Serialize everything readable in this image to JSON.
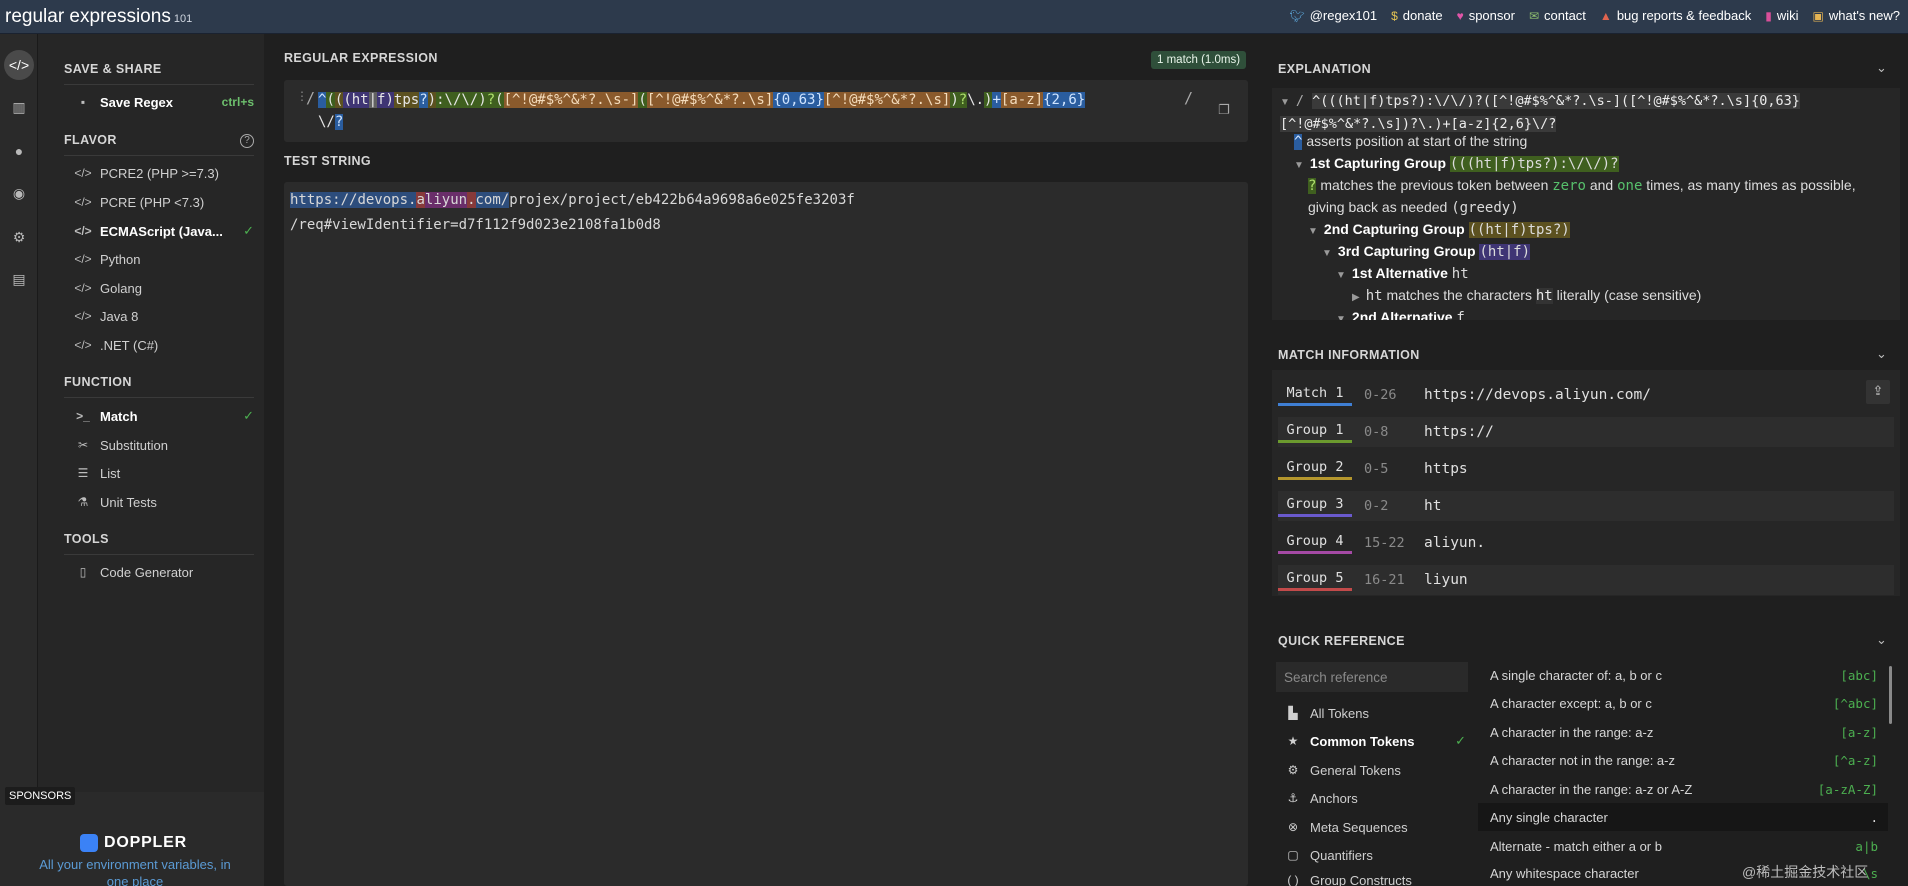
{
  "app": {
    "logo_main": "regular",
    "logo_rest": " expressions",
    "version": "101"
  },
  "top_links": [
    {
      "label": "@regex101",
      "icon": "twitter-icon"
    },
    {
      "label": "donate",
      "icon": "dollar-icon"
    },
    {
      "label": "sponsor",
      "icon": "heart-icon"
    },
    {
      "label": "contact",
      "icon": "mail-icon"
    },
    {
      "label": "bug reports & feedback",
      "icon": "warning-icon"
    },
    {
      "label": "wiki",
      "icon": "book-icon"
    },
    {
      "label": "what's new?",
      "icon": "news-icon"
    }
  ],
  "sidebar": {
    "save_header": "SAVE & SHARE",
    "save_label": "Save Regex",
    "save_shortcut": "ctrl+s",
    "flavor_header": "FLAVOR",
    "flavors": [
      "PCRE2 (PHP >=7.3)",
      "PCRE (PHP <7.3)",
      "ECMAScript (Java...",
      "Python",
      "Golang",
      "Java 8",
      ".NET (C#)"
    ],
    "function_header": "FUNCTION",
    "functions": [
      "Match",
      "Substitution",
      "List",
      "Unit Tests"
    ],
    "tools_header": "TOOLS",
    "tools": [
      "Code Generator"
    ]
  },
  "sponsor": {
    "label": "SPONSORS",
    "name": "DOPPLER",
    "text": "All your environment variables, in one place"
  },
  "regex": {
    "header": "REGULAR EXPRESSION",
    "match_badge": "1 match (1.0ms)",
    "delim_open": "/",
    "delim_close": "/",
    "parts": [
      "^",
      "(",
      "(",
      "(",
      "ht",
      "|",
      "f",
      ")",
      "tps",
      "?",
      ")",
      ":\\/\\/",
      ")",
      "?",
      "(",
      "[^!@#$%^&*?.\\s-]",
      "(",
      "[^!@#$%^&*?.\\s]",
      "{0,63}",
      "[^!@#$%^&*?.\\s]",
      ")",
      "?",
      "\\.",
      ")",
      "+",
      "[a-z]",
      "{2,6}",
      "\\/",
      "?"
    ]
  },
  "test_string": {
    "header": "TEST STRING",
    "m_https": "https",
    "m_sep": "://",
    "m_devops": "devops.",
    "m_a": "a",
    "m_liyun": "liyun",
    "m_dot": ".",
    "m_com": "com/",
    "rest_line1": "projex/project/eb422b64a9698a6e025fe3203f",
    "line2": "/req#viewIdentifier=d7f112f9d023e2108fa1b0d8"
  },
  "explanation": {
    "header": "EXPLANATION",
    "regex": "^(((ht|f)tps?):\\/\\/)?([^!@#$%^&*?.\\s-]([^!@#$%^&*?.\\s]{0,63}[^!@#$%^&*?.\\s])?\\.)+[a-z]{2,6}\\/?",
    "l1_token": "^",
    "l1_text": " asserts position at start of the string",
    "l2_title": "1st Capturing Group",
    "l2_code": "(((ht|f)tps?):\\/\\/)?",
    "l3_token": "?",
    "l3_text_a": " matches the previous token between ",
    "l3_zero": "zero",
    "l3_and": " and ",
    "l3_one": "one",
    "l3_text_b": " times, as many times as possible,",
    "l4_text": "giving back as needed ",
    "l4_code": "(greedy)",
    "l5_title": "2nd Capturing Group",
    "l5_code": "((ht|f)tps?)",
    "l6_title": "3rd Capturing Group",
    "l6_code": "(ht|f)",
    "l7_title": "1st Alternative",
    "l7_code": "ht",
    "l8_code": "ht",
    "l8_text_a": " matches the characters ",
    "l8_code2": "ht",
    "l8_text_b": " literally (case sensitive)",
    "l9_title": "2nd Alternative",
    "l9_code": "f"
  },
  "match_info": {
    "header": "MATCH INFORMATION",
    "rows": [
      {
        "label": "Match 1",
        "range": "0-26",
        "value": "https://devops.aliyun.com/",
        "color": "#3f7fd4"
      },
      {
        "label": "Group 1",
        "range": "0-8",
        "value": "https://",
        "color": "#6b9a2e"
      },
      {
        "label": "Group 2",
        "range": "0-5",
        "value": "https",
        "color": "#b4962d"
      },
      {
        "label": "Group 3",
        "range": "0-2",
        "value": "ht",
        "color": "#6a5acd"
      },
      {
        "label": "Group 4",
        "range": "15-22",
        "value": "aliyun.",
        "color": "#a54aa5"
      },
      {
        "label": "Group 5",
        "range": "16-21",
        "value": "liyun",
        "color": "#c24a4a"
      }
    ]
  },
  "quick_ref": {
    "header": "QUICK REFERENCE",
    "search_placeholder": "Search reference",
    "categories": [
      "All Tokens",
      "Common Tokens",
      "General Tokens",
      "Anchors",
      "Meta Sequences",
      "Quantifiers",
      "Group Constructs"
    ],
    "rows": [
      {
        "desc": "A single character of: a, b or c",
        "token": "[abc]"
      },
      {
        "desc": "A character except: a, b or c",
        "token": "[^abc]"
      },
      {
        "desc": "A character in the range: a-z",
        "token": "[a-z]"
      },
      {
        "desc": "A character not in the range: a-z",
        "token": "[^a-z]"
      },
      {
        "desc": "A character in the range: a-z or A-Z",
        "token": "[a-zA-Z]"
      },
      {
        "desc": "Any single character",
        "token": "."
      },
      {
        "desc": "Alternate - match either a or b",
        "token": "a|b"
      },
      {
        "desc": "Any whitespace character",
        "token": "\\s"
      }
    ]
  },
  "watermark": "@稀土掘金技术社区",
  "colors": {
    "topbar": "#2d3a4c",
    "accent_green": "#4caf50",
    "match_blue": "#2d4d7c"
  }
}
